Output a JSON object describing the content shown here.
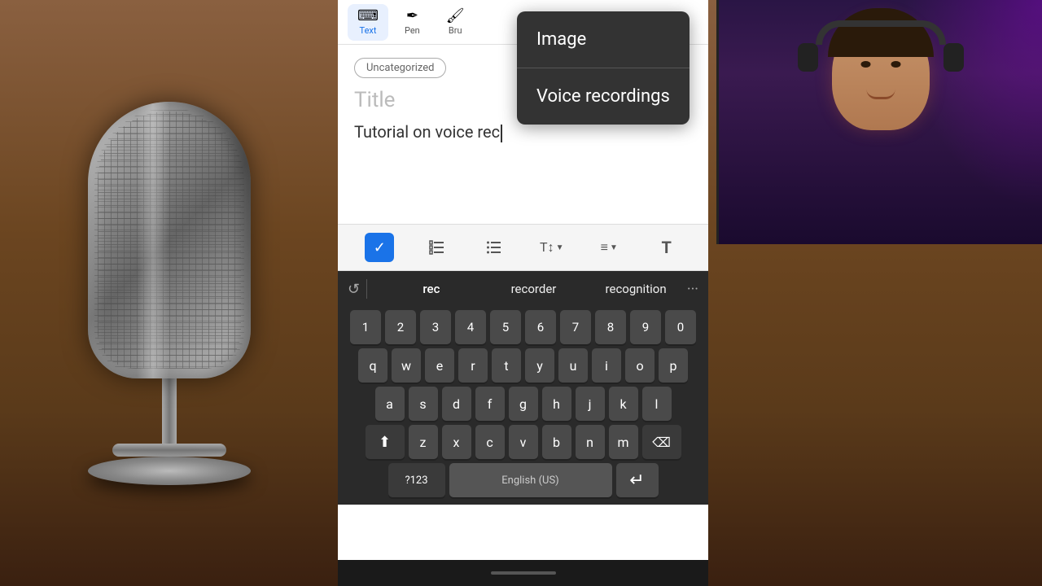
{
  "background": {
    "left_panel_label": "microphone-background",
    "right_panel_label": "webcam-background"
  },
  "toolbar": {
    "text_label": "Text",
    "pen_label": "Pen",
    "brush_label": "Bru"
  },
  "note": {
    "category": "Uncategorized",
    "title": "Title",
    "body_text": "Tutorial on voice rec",
    "cursor_visible": true
  },
  "dropdown": {
    "image_label": "Image",
    "voice_recordings_label": "Voice recordings"
  },
  "format_bar": {
    "check_label": "✓",
    "list_ordered": "☰",
    "list_unordered": "≡",
    "text_size": "T↕",
    "align": "≡↕",
    "text_format": "T"
  },
  "autocomplete": {
    "icon": "↺",
    "word1": "rec",
    "word2": "recorder",
    "word3": "recognition",
    "more": "···"
  },
  "keyboard": {
    "numbers": [
      "1",
      "2",
      "3",
      "4",
      "5",
      "6",
      "7",
      "8",
      "9",
      "0"
    ],
    "row1": [
      "q",
      "w",
      "e",
      "r",
      "t",
      "y",
      "u",
      "i",
      "o",
      "p"
    ],
    "row2": [
      "a",
      "s",
      "d",
      "f",
      "g",
      "h",
      "j",
      "k",
      "l"
    ],
    "row3": [
      "z",
      "x",
      "c",
      "v",
      "b",
      "n",
      "m"
    ],
    "shift_icon": "⬆",
    "delete_icon": "⌫",
    "bottom_left": "?123",
    "bottom_mid": "English (US)",
    "bottom_right": "↵"
  },
  "webcam": {
    "person_label": "streamer"
  }
}
